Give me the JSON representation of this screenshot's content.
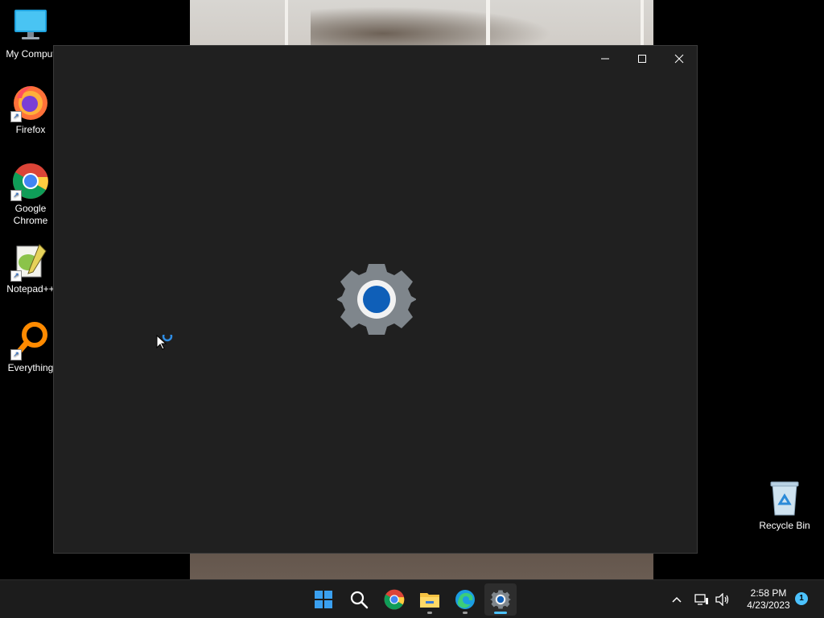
{
  "desktop": {
    "icons": [
      {
        "label": "My Comput"
      },
      {
        "label": "Firefox"
      },
      {
        "label": "Google Chrome"
      },
      {
        "label": "Notepad++"
      },
      {
        "label": "Everything"
      },
      {
        "label": "Recycle Bin"
      }
    ]
  },
  "window": {
    "app_icon": "settings-gear-icon",
    "accent_color": "#0f5fb8",
    "background_color": "#202020"
  },
  "taskbar": {
    "apps": [
      "Start",
      "Search",
      "Google Chrome",
      "File Explorer",
      "Microsoft Edge",
      "Settings"
    ],
    "active_app": "Settings",
    "time": "2:58 PM",
    "date": "4/23/2023",
    "notification_count": "1",
    "accent_color": "#4cc2ff"
  }
}
